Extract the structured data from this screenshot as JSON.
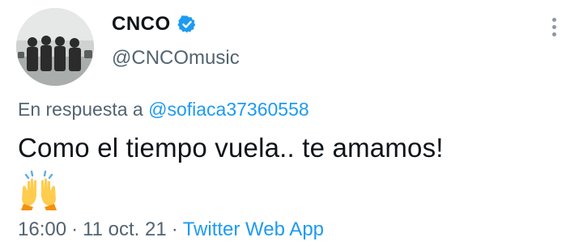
{
  "author": {
    "display_name": "CNCO",
    "handle": "@CNCOmusic",
    "verified": true,
    "avatar": "band-photo-avatar"
  },
  "reply": {
    "prefix": "En respuesta a",
    "handle": "@sofiaca37360558"
  },
  "tweet": {
    "text": "Como el tiempo vuela.. te amamos!",
    "emoji": "raising-hands-emoji"
  },
  "meta": {
    "time": "16:00",
    "separator": "·",
    "date": "11 oct. 21",
    "source": "Twitter Web App"
  },
  "icons": {
    "more": "more-options-icon",
    "verified": "verified-badge-icon"
  },
  "colors": {
    "accent": "#1d9bf0",
    "muted": "#536471",
    "text": "#0f1419"
  }
}
